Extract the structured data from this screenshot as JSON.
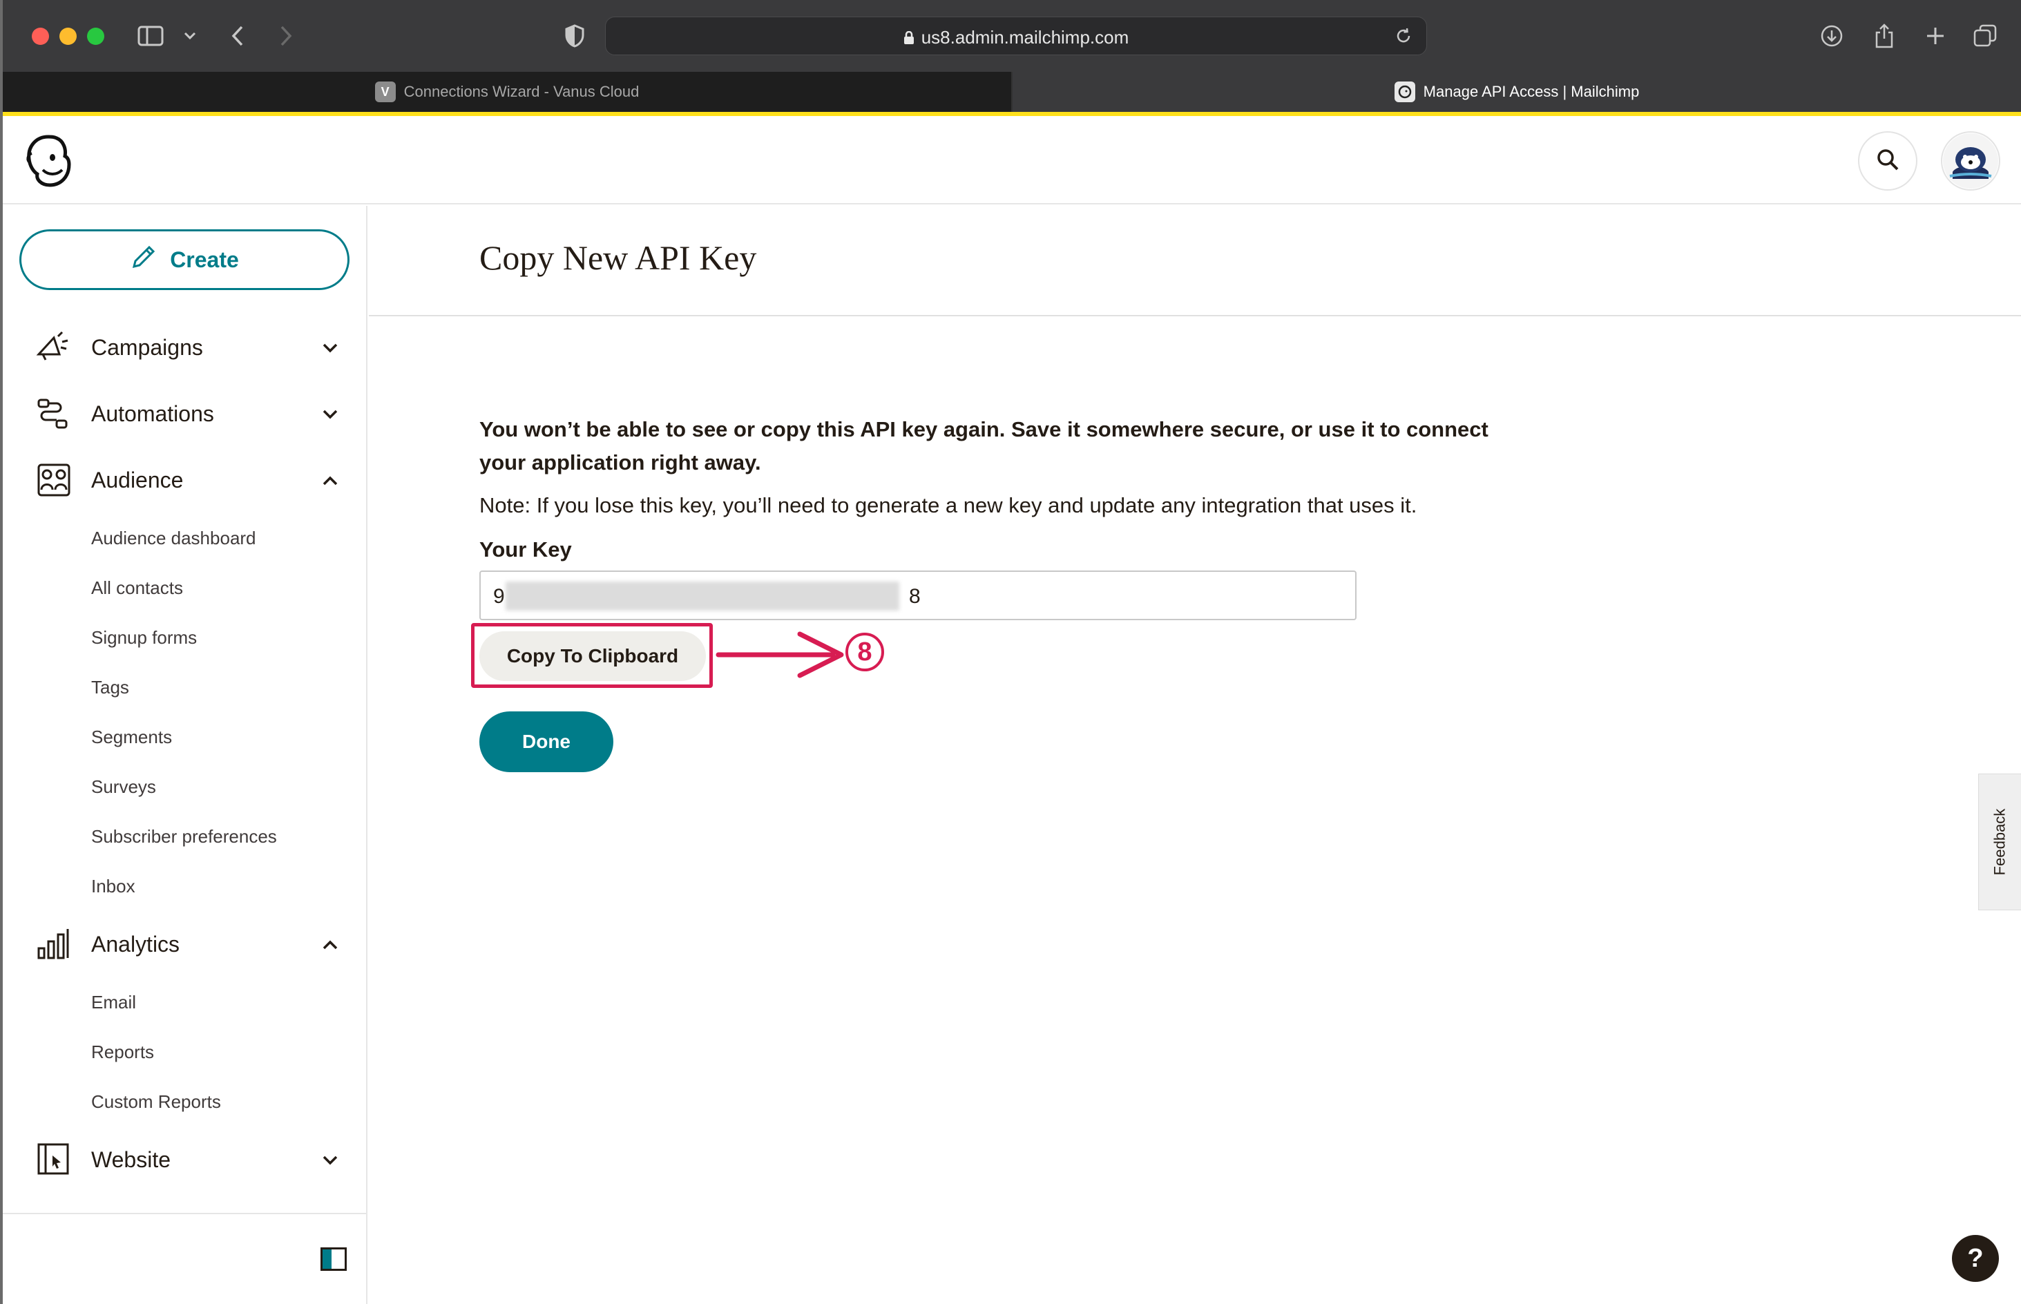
{
  "browser": {
    "url": "us8.admin.mailchimp.com",
    "tabs": [
      {
        "label": "Connections Wizard - Vanus Cloud",
        "favicon": "V",
        "active": false
      },
      {
        "label": "Manage API Access | Mailchimp",
        "favicon": "mailchimp-icon",
        "active": true
      }
    ]
  },
  "sidebar": {
    "create_label": "Create",
    "nav": {
      "campaigns": "Campaigns",
      "automations": "Automations",
      "audience": "Audience",
      "analytics": "Analytics",
      "website": "Website"
    },
    "audience_items": [
      "Audience dashboard",
      "All contacts",
      "Signup forms",
      "Tags",
      "Segments",
      "Surveys",
      "Subscriber preferences",
      "Inbox"
    ],
    "analytics_items": [
      "Email",
      "Reports",
      "Custom Reports"
    ]
  },
  "main": {
    "title": "Copy New API Key",
    "warning": "You won’t be able to see or copy this API key again. Save it somewhere secure, or use it to connect your application right away.",
    "note": "Note: If you lose this key, you’ll need to generate a new key and update any integration that uses it.",
    "key_label": "Your Key",
    "key_start": "9",
    "key_end": "8",
    "copy_label": "Copy To Clipboard",
    "step_number": "8",
    "done_label": "Done"
  },
  "feedback_label": "Feedback",
  "help_label": "?",
  "colors": {
    "accent": "#007c89",
    "annotation": "#d71c52",
    "brand_yellow": "#ffe01b"
  }
}
